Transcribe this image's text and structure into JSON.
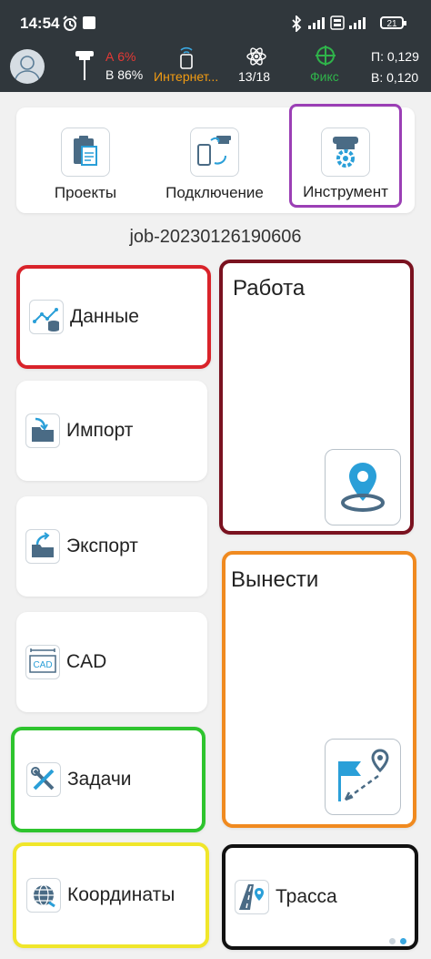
{
  "status_bar": {
    "time": "14:54",
    "battery": "21"
  },
  "header": {
    "rover_line1": "А 6%",
    "rover_line2": "В 86%",
    "connection": "Интернет...",
    "satellites": "13/18",
    "fix": "Фикс",
    "precision_h": "П: 0,129",
    "precision_v": "В: 0,120",
    "colors": {
      "rover_alert": "#e53935",
      "connection": "#f39c12",
      "fix": "#2fb34a"
    }
  },
  "top_menu": {
    "items": [
      {
        "label": "Проекты",
        "icon": "clipboard-icon"
      },
      {
        "label": "Подключение",
        "icon": "device-connection-icon"
      },
      {
        "label": "Инструмент",
        "icon": "gnss-receiver-settings-icon",
        "highlight": "#9b3fb5"
      }
    ]
  },
  "job_name": "job-20230126190606",
  "tiles": {
    "data": {
      "label": "Данные",
      "icon": "data-chart-icon",
      "border": "#d9232a"
    },
    "import": {
      "label": "Импорт",
      "icon": "folder-import-icon"
    },
    "export": {
      "label": "Экспорт",
      "icon": "folder-export-icon"
    },
    "cad": {
      "label": "CAD",
      "icon": "cad-icon"
    },
    "tasks": {
      "label": "Задачи",
      "icon": "tools-icon",
      "border": "#2ec42e"
    },
    "coords": {
      "label": "Координаты",
      "icon": "globe-icon",
      "border": "#f0e62a"
    },
    "work": {
      "label": "Работа",
      "icon": "location-pin-icon",
      "border": "#7a1220"
    },
    "stakeout": {
      "label": "Вынести",
      "icon": "stakeout-flag-icon",
      "border": "#f08a20"
    },
    "route": {
      "label": "Трасса",
      "icon": "road-route-icon",
      "border": "#111111"
    }
  },
  "pager": {
    "pages": 2,
    "active": 2
  }
}
